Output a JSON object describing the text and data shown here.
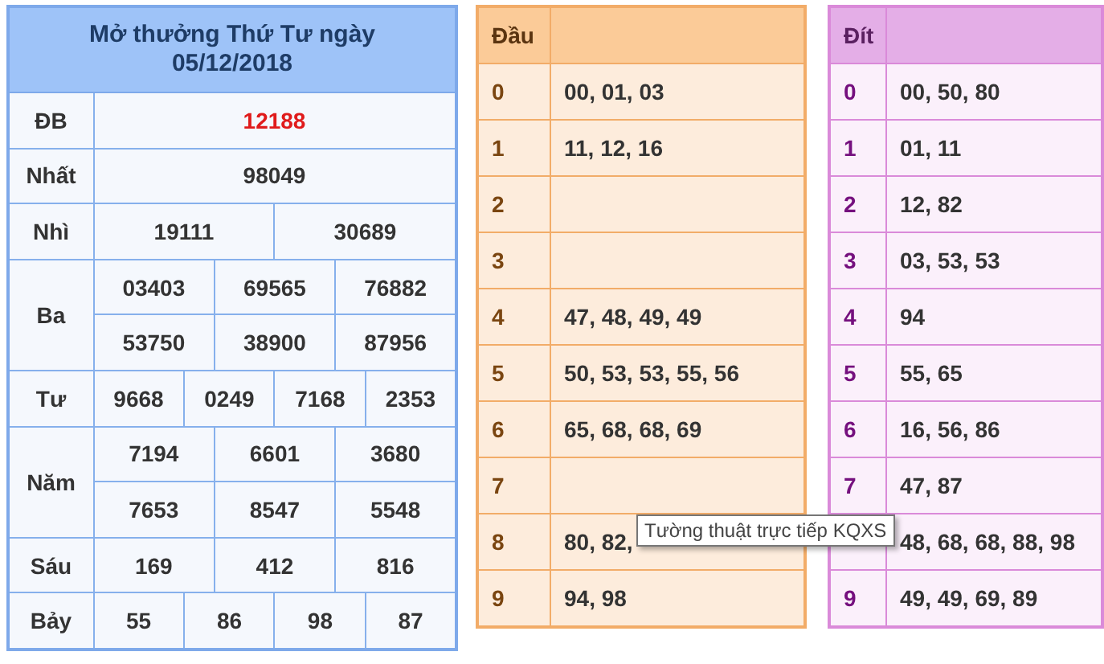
{
  "results": {
    "title": "Mở thưởng Thứ Tư ngày 05/12/2018",
    "prizes": [
      {
        "name": "ĐB",
        "kind": "special",
        "rows": [
          [
            "12188"
          ]
        ]
      },
      {
        "name": "Nhất",
        "kind": "normal",
        "rows": [
          [
            "98049"
          ]
        ]
      },
      {
        "name": "Nhì",
        "kind": "normal",
        "rows": [
          [
            "19111",
            "30689"
          ]
        ]
      },
      {
        "name": "Ba",
        "kind": "normal",
        "rows": [
          [
            "03403",
            "69565",
            "76882"
          ],
          [
            "53750",
            "38900",
            "87956"
          ]
        ]
      },
      {
        "name": "Tư",
        "kind": "normal",
        "rows": [
          [
            "9668",
            "0249",
            "7168",
            "2353"
          ]
        ]
      },
      {
        "name": "Năm",
        "kind": "normal",
        "rows": [
          [
            "7194",
            "6601",
            "3680"
          ],
          [
            "7653",
            "8547",
            "5548"
          ]
        ]
      },
      {
        "name": "Sáu",
        "kind": "normal",
        "rows": [
          [
            "169",
            "412",
            "816"
          ]
        ]
      },
      {
        "name": "Bảy",
        "kind": "normal",
        "rows": [
          [
            "55",
            "86",
            "98",
            "87"
          ]
        ]
      }
    ]
  },
  "tables": [
    {
      "kind": "dau",
      "heading": "Đầu",
      "rows": [
        {
          "key": "0",
          "values": "00, 01, 03"
        },
        {
          "key": "1",
          "values": "11, 12, 16"
        },
        {
          "key": "2"
        },
        {
          "key": "3"
        },
        {
          "key": "4",
          "values": "47, 48, 49, 49"
        },
        {
          "key": "5",
          "values": "50, 53, 53, 55, 56"
        },
        {
          "key": "6",
          "values": "65, 68, 68, 69"
        },
        {
          "key": "7"
        },
        {
          "key": "8",
          "values": "80, 82,"
        },
        {
          "key": "9",
          "values": "94, 98"
        }
      ]
    },
    {
      "kind": "dit",
      "heading": "Đít",
      "rows": [
        {
          "key": "0",
          "values": "00, 50, 80"
        },
        {
          "key": "1",
          "values": "01, 11"
        },
        {
          "key": "2",
          "values": "12, 82"
        },
        {
          "key": "3",
          "values": "03, 53, 53"
        },
        {
          "key": "4",
          "values": "94"
        },
        {
          "key": "5",
          "values": "55, 65"
        },
        {
          "key": "6",
          "values": "16, 56, 86"
        },
        {
          "key": "7",
          "values": "47, 87"
        },
        {
          "values": "48, 68, 68, 88, 98"
        },
        {
          "key": "9",
          "values": "49, 49, 69, 89"
        }
      ]
    }
  ],
  "tooltip": {
    "text": "Tường thuật trực tiếp KQXS"
  }
}
